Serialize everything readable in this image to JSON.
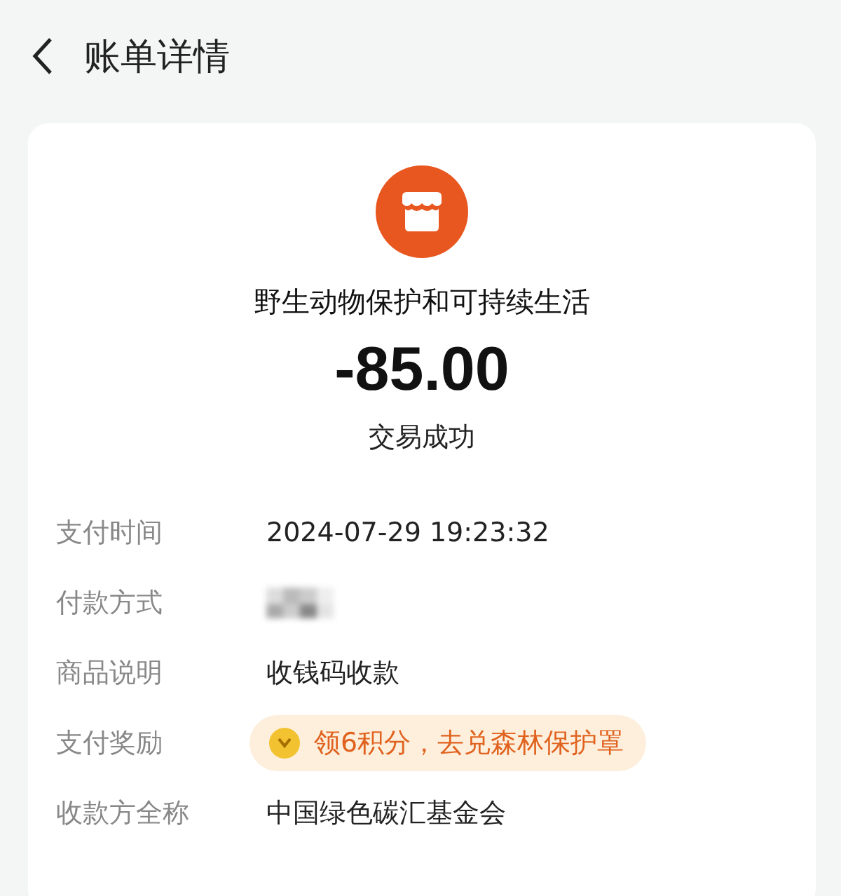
{
  "header": {
    "title": "账单详情"
  },
  "merchant": {
    "name": "野生动物保护和可持续生活",
    "amount": "-85.00",
    "status": "交易成功"
  },
  "rows": [
    {
      "kind": "text",
      "label": "支付时间",
      "value": "2024-07-29 19:23:32"
    },
    {
      "kind": "blurred",
      "label": "付款方式"
    },
    {
      "kind": "text",
      "label": "商品说明",
      "value": "收钱码收款"
    },
    {
      "kind": "reward",
      "label": "支付奖励",
      "value": "领6积分，去兑森林保护罩"
    },
    {
      "kind": "text",
      "label": "收款方全称",
      "value": "中国绿色碳汇基金会"
    }
  ]
}
